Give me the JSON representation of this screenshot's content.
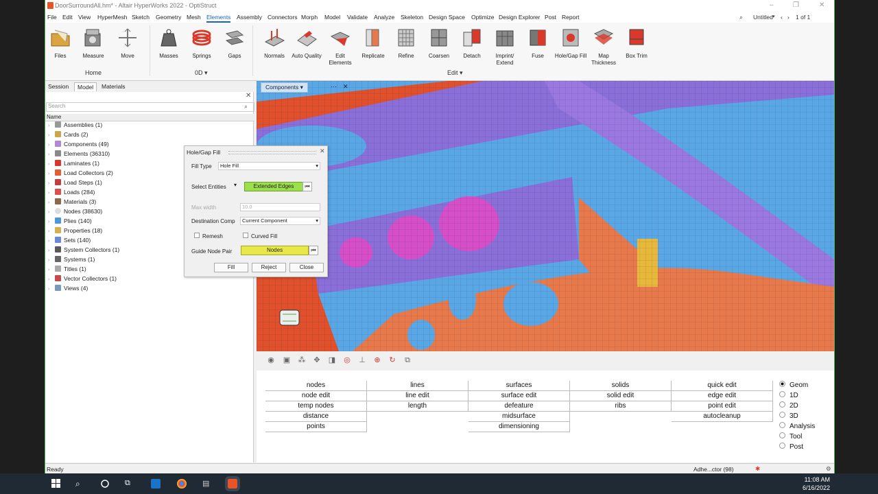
{
  "window": {
    "title": "DoorSurroundAll.hm* - Altair HyperWorks 2022 - OptiStruct"
  },
  "menu": {
    "items": [
      "File",
      "Edit",
      "View",
      "HyperMesh",
      "Sketch",
      "Geometry",
      "Mesh",
      "Elements",
      "Assembly",
      "Connectors",
      "Morph",
      "Model",
      "Validate",
      "Analyze",
      "Skeleton",
      "Design Space",
      "Optimize",
      "Design Explorer",
      "Post",
      "Report"
    ],
    "active": "Elements",
    "session_name": "Untitled",
    "page_count": "1 of 1"
  },
  "ribbon": {
    "tools": [
      "Files",
      "Measure",
      "Move",
      "Masses",
      "Springs",
      "Gaps",
      "Normals",
      "Auto Quality",
      "Edit\nElements",
      "Replicate",
      "Refine",
      "Coarsen",
      "Detach",
      "Imprint/\nExtend",
      "Fuse",
      "Hole/Gap Fill",
      "Map\nThickness",
      "Box Trim"
    ],
    "groups": {
      "home": "Home",
      "zero_d": "0D",
      "edit": "Edit"
    }
  },
  "left_panel": {
    "tabs": [
      "Session",
      "Model",
      "Materials"
    ],
    "active_tab": "Model",
    "search_placeholder": "Search",
    "column": "Name",
    "tree": [
      {
        "label": "Assemblies",
        "count": "(1)"
      },
      {
        "label": "Cards",
        "count": "(2)"
      },
      {
        "label": "Components",
        "count": "(49)"
      },
      {
        "label": "Elements",
        "count": "(36310)"
      },
      {
        "label": "Laminates",
        "count": "(1)"
      },
      {
        "label": "Load Collectors",
        "count": "(2)"
      },
      {
        "label": "Load Steps",
        "count": "(1)"
      },
      {
        "label": "Loads",
        "count": "(284)"
      },
      {
        "label": "Materials",
        "count": "(3)"
      },
      {
        "label": "Nodes",
        "count": "(38630)"
      },
      {
        "label": "Plies",
        "count": "(140)"
      },
      {
        "label": "Properties",
        "count": "(18)"
      },
      {
        "label": "Sets",
        "count": "(140)"
      },
      {
        "label": "System Collectors",
        "count": "(1)"
      },
      {
        "label": "Systems",
        "count": "(1)"
      },
      {
        "label": "Titles",
        "count": "(1)"
      },
      {
        "label": "Vector Collectors",
        "count": "(1)"
      },
      {
        "label": "Views",
        "count": "(4)"
      }
    ]
  },
  "dialog": {
    "title": "Hole/Gap Fill",
    "fill_type_label": "Fill Type",
    "fill_type_value": "Hole Fill",
    "select_entities_label": "Select Entities",
    "select_entities_value": "Extended Edges",
    "max_width_label": "Max width",
    "max_width_value": "10.0",
    "dest_comp_label": "Destination Comp",
    "dest_comp_value": "Current Component",
    "remesh_label": "Remesh",
    "curved_fill_label": "Curved Fill",
    "guide_label": "Guide Node Pair",
    "guide_value": "Nodes",
    "fill_btn": "Fill",
    "reject_btn": "Reject",
    "close_btn": "Close"
  },
  "viewport": {
    "components_tab": "Components"
  },
  "panel": {
    "columns": [
      [
        "nodes",
        "node edit",
        "temp nodes",
        "distance",
        "points"
      ],
      [
        "lines",
        "line edit",
        "length"
      ],
      [
        "surfaces",
        "surface edit",
        "defeature",
        "midsurface",
        "dimensioning"
      ],
      [
        "solids",
        "solid edit",
        "ribs"
      ],
      [
        "quick edit",
        "edge edit",
        "point edit",
        "autocleanup"
      ]
    ],
    "radios": [
      "Geom",
      "1D",
      "2D",
      "3D",
      "Analysis",
      "Tool",
      "Post"
    ],
    "selected_radio": "Geom"
  },
  "status": {
    "text": "Ready",
    "right": "Adhe...ctor (98)"
  },
  "taskbar": {
    "time": "11:08 AM",
    "date": "6/16/2022"
  },
  "colors": {
    "accent": "#1565c0",
    "highlight_yellow": "#e8e84a",
    "highlight_green": "#9be04a",
    "mesh_orange": "#e8794a",
    "mesh_purple": "#8a6fd8",
    "mesh_blue": "#5aa7e6",
    "mesh_magenta": "#d64fc8"
  }
}
